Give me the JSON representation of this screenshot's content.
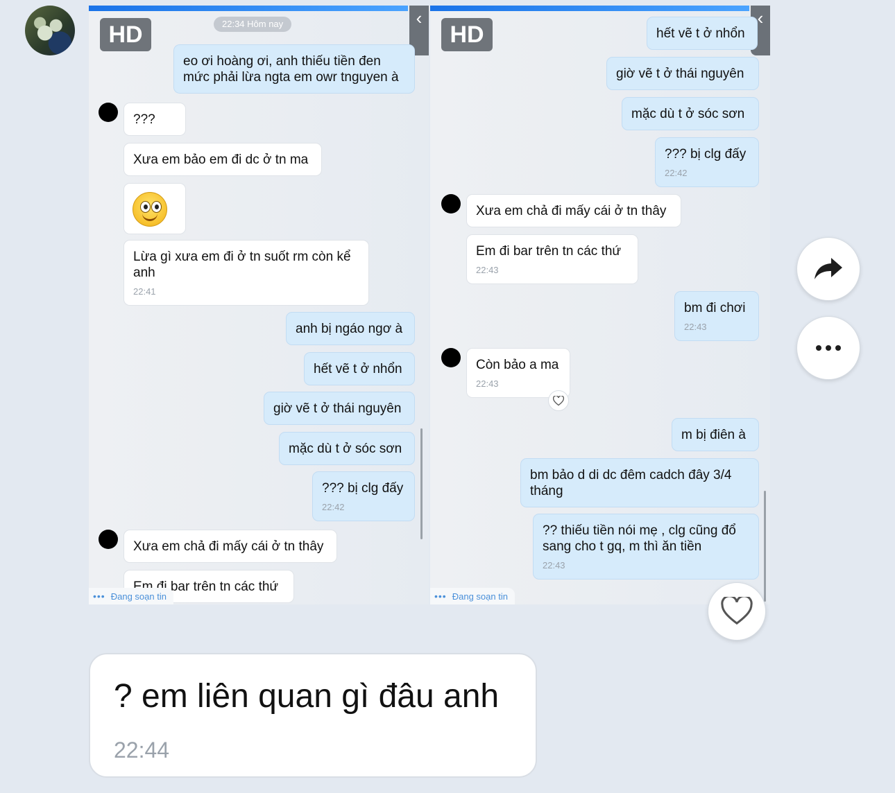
{
  "hd_label": "HD",
  "time_chip": "22:34 Hôm nay",
  "typing_label": "Đang soạn tin",
  "left_messages": [
    {
      "text": "eo ơi hoàng ơi, anh thiếu tiền đen mức phải lừa ngta em owr tnguyen à"
    },
    {
      "text": "???"
    },
    {
      "text": "Xưa em bảo em đi dc ở tn ma"
    },
    {
      "text": "Lừa gì xưa em đi ở tn suốt rm còn kể anh",
      "time": "22:41"
    },
    {
      "text": "anh bị ngáo ngơ à"
    },
    {
      "text": "hết vẽ t ở nhổn"
    },
    {
      "text": "giờ vẽ t ở thái nguyên"
    },
    {
      "text": "mặc dù t ở sóc sơn"
    },
    {
      "text": "??? bị clg đấy",
      "time": "22:42"
    },
    {
      "text": "Xưa em chả đi mấy cái ở tn thây"
    },
    {
      "text": "Em đi bar trên tn các thứ"
    }
  ],
  "right_messages": [
    {
      "text": "hết vẽ t ở nhổn"
    },
    {
      "text": "giờ vẽ t ở thái nguyên"
    },
    {
      "text": "mặc dù t ở sóc sơn"
    },
    {
      "text": "??? bị clg đấy",
      "time": "22:42"
    },
    {
      "text": "Xưa em chả đi mấy cái ở tn thây"
    },
    {
      "text": "Em đi bar trên tn các thứ",
      "time": "22:43"
    },
    {
      "text": "bm đi chơi",
      "time": "22:43"
    },
    {
      "text": "Còn bảo a ma",
      "time": "22:43"
    },
    {
      "text": "m bị điên à"
    },
    {
      "text": "bm bảo d di dc đêm cadch đây 3/4 tháng"
    },
    {
      "text": "?? thiếu tiền nói mẹ , clg cũng đổ sang cho t gq, m thì ăn tiền",
      "time": "22:43"
    }
  ],
  "final_message": {
    "text": "? em liên quan gì đâu anh",
    "time": "22:44"
  },
  "icons": {
    "share": "share-arrow-icon",
    "more": "more-dots-icon",
    "heart": "heart-icon",
    "back": "chevron-left-icon"
  }
}
